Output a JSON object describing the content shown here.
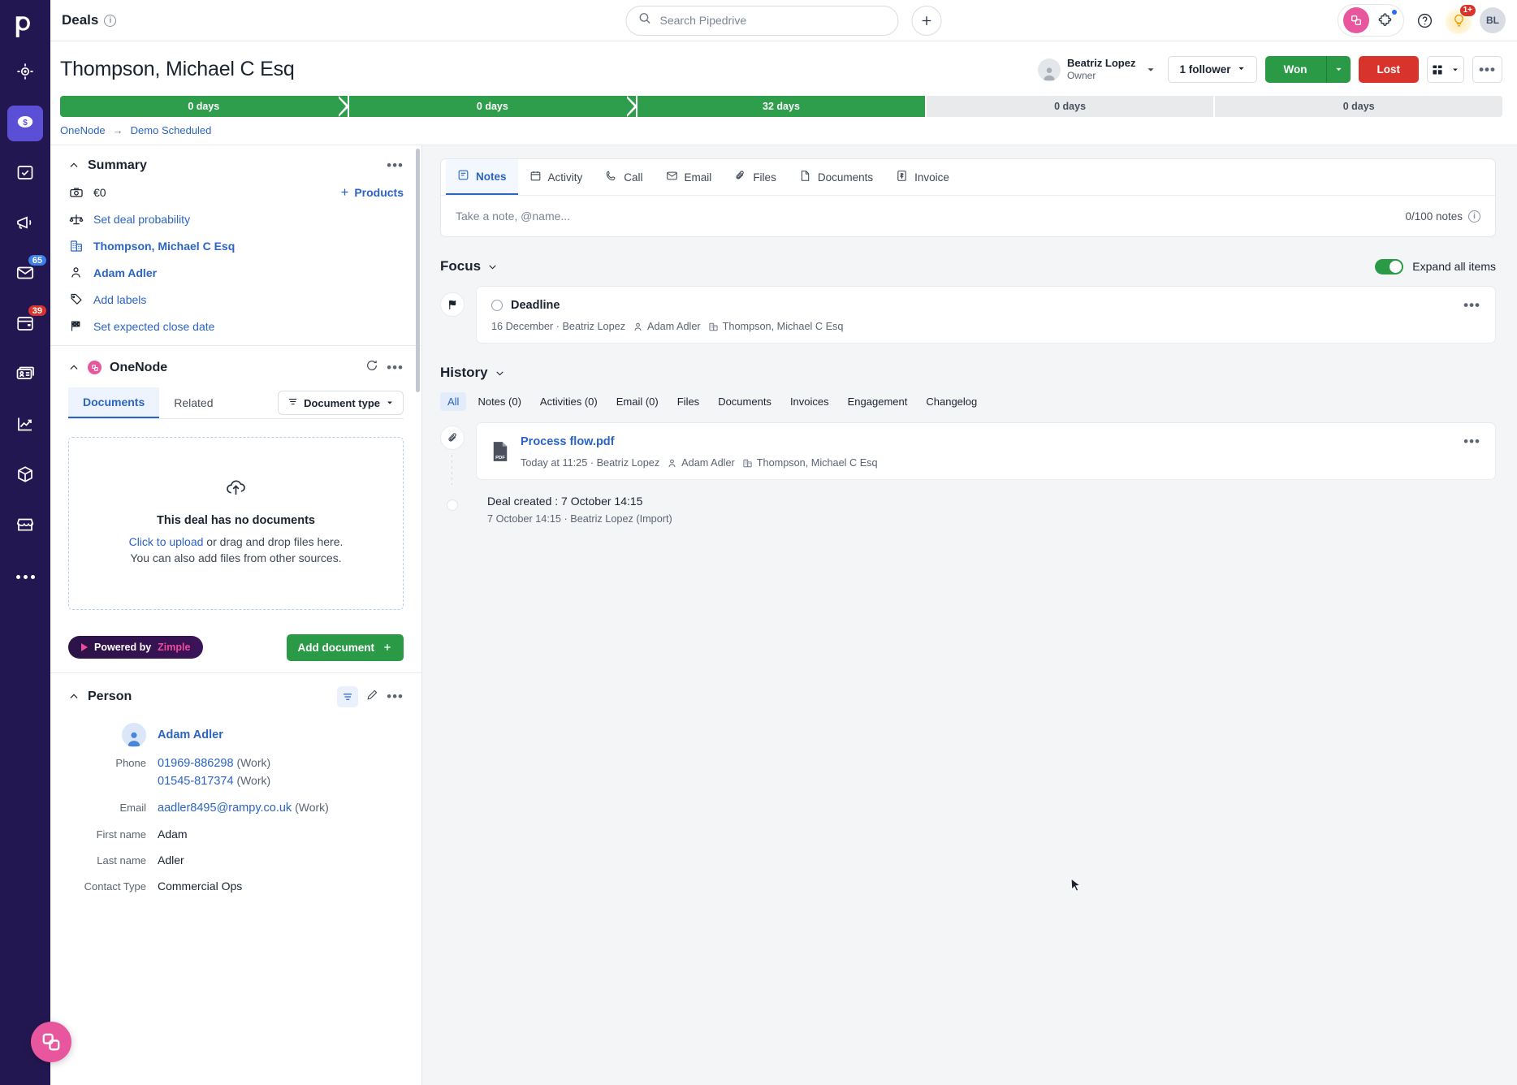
{
  "rail": {
    "logo": "pipedrive-logo",
    "items": [
      {
        "name": "leads-inbox",
        "icon": "target-icon",
        "active": false,
        "badge": null
      },
      {
        "name": "deals",
        "icon": "dollar-coin-icon",
        "active": true,
        "badge": null
      },
      {
        "name": "activities",
        "icon": "calendar-check-icon",
        "active": false,
        "badge": null
      },
      {
        "name": "campaigns",
        "icon": "megaphone-icon",
        "active": false,
        "badge": null
      },
      {
        "name": "mail",
        "icon": "envelope-icon",
        "active": false,
        "badge": "65",
        "badge_color": "#3D7FE8"
      },
      {
        "name": "calendar",
        "icon": "calendar-icon",
        "active": false,
        "badge": "39",
        "badge_color": "#D9342B"
      },
      {
        "name": "contacts",
        "icon": "contact-card-icon",
        "active": false,
        "badge": null
      },
      {
        "name": "insights",
        "icon": "chart-line-icon",
        "active": false,
        "badge": null
      },
      {
        "name": "products",
        "icon": "box-icon",
        "active": false,
        "badge": null
      },
      {
        "name": "marketplace",
        "icon": "storefront-icon",
        "active": false,
        "badge": null
      },
      {
        "name": "more",
        "icon": "ellipsis-icon",
        "active": false,
        "badge": null
      }
    ]
  },
  "topbar": {
    "title": "Deals",
    "search_placeholder": "Search Pipedrive",
    "search_value": "",
    "add_label": "+",
    "notifications_badge": "1+",
    "avatar_initials": "BL"
  },
  "deal": {
    "title": "Thompson, Michael C Esq",
    "owner_name": "Beatriz Lopez",
    "owner_role": "Owner",
    "followers_label": "1 follower",
    "won_label": "Won",
    "lost_label": "Lost",
    "stages": [
      {
        "label": "0 days",
        "state": "done"
      },
      {
        "label": "0 days",
        "state": "done"
      },
      {
        "label": "32 days",
        "state": "done"
      },
      {
        "label": "0 days",
        "state": "todo"
      },
      {
        "label": "0 days",
        "state": "todo"
      }
    ],
    "breadcrumb": {
      "pipeline": "OneNode",
      "separator": "→",
      "stage": "Demo Scheduled"
    }
  },
  "summary": {
    "title": "Summary",
    "products_label": "Products",
    "rows": [
      {
        "icon": "money-icon",
        "text": "€0",
        "link": false
      },
      {
        "icon": "scales-icon",
        "text": "Set deal probability",
        "link": true
      },
      {
        "icon": "organization-icon",
        "text": "Thompson, Michael C Esq",
        "link": true,
        "bold": true
      },
      {
        "icon": "person-icon",
        "text": "Adam Adler",
        "link": true,
        "bold": true
      },
      {
        "icon": "label-tag-icon",
        "text": "Add labels",
        "link": true
      },
      {
        "icon": "flag-checkered-icon",
        "text": "Set expected close date",
        "link": true
      }
    ]
  },
  "onenode": {
    "title": "OneNode",
    "tabs": [
      {
        "label": "Documents",
        "active": true
      },
      {
        "label": "Related",
        "active": false
      }
    ],
    "doc_type_filter": "Document type",
    "dropzone": {
      "title": "This deal has no documents",
      "link": "Click to upload",
      "rest": " or drag and drop files here.",
      "line2": "You can also add files from other sources."
    },
    "powered_by_prefix": "Powered by ",
    "powered_by_brand": "Zimple",
    "add_document_label": "Add document"
  },
  "person": {
    "title": "Person",
    "name": "Adam Adler",
    "fields": [
      {
        "label": "Phone",
        "values": [
          {
            "v": "01969-886298",
            "tag": "(Work)",
            "link": true
          },
          {
            "v": "01545-817374",
            "tag": "(Work)",
            "link": true
          }
        ]
      },
      {
        "label": "Email",
        "values": [
          {
            "v": "aadler8495@rampy.co.uk",
            "tag": "(Work)",
            "link": true
          }
        ]
      },
      {
        "label": "First name",
        "values": [
          {
            "v": "Adam",
            "tag": "",
            "link": false
          }
        ]
      },
      {
        "label": "Last name",
        "values": [
          {
            "v": "Adler",
            "tag": "",
            "link": false
          }
        ]
      },
      {
        "label": "Contact Type",
        "values": [
          {
            "v": "Commercial Ops",
            "tag": "",
            "link": false
          }
        ]
      }
    ]
  },
  "notes_panel": {
    "tabs": [
      {
        "label": "Notes",
        "icon": "note-icon",
        "active": true
      },
      {
        "label": "Activity",
        "icon": "calendar-icon",
        "active": false
      },
      {
        "label": "Call",
        "icon": "phone-icon",
        "active": false
      },
      {
        "label": "Email",
        "icon": "envelope-icon",
        "active": false
      },
      {
        "label": "Files",
        "icon": "paperclip-icon",
        "active": false
      },
      {
        "label": "Documents",
        "icon": "document-icon",
        "active": false
      },
      {
        "label": "Invoice",
        "icon": "invoice-icon",
        "active": false
      }
    ],
    "note_placeholder": "Take a note, @name...",
    "note_value": "",
    "note_counter": "0/100 notes"
  },
  "focus": {
    "title": "Focus",
    "expand_label": "Expand all items",
    "expand_on": true,
    "items": [
      {
        "icon": "flag-icon",
        "title": "Deadline",
        "date": "16 December",
        "author": "Beatriz Lopez",
        "person": "Adam Adler",
        "org": "Thompson, Michael C Esq"
      }
    ]
  },
  "history": {
    "title": "History",
    "filters": [
      {
        "label": "All",
        "active": true
      },
      {
        "label": "Notes (0)",
        "active": false
      },
      {
        "label": "Activities (0)",
        "active": false
      },
      {
        "label": "Email (0)",
        "active": false
      },
      {
        "label": "Files",
        "active": false
      },
      {
        "label": "Documents",
        "active": false
      },
      {
        "label": "Invoices",
        "active": false
      },
      {
        "label": "Engagement",
        "active": false
      },
      {
        "label": "Changelog",
        "active": false
      }
    ],
    "file_item": {
      "icon": "paperclip-icon",
      "file_icon": "pdf-icon",
      "name": "Process flow.pdf",
      "time": "Today at 11:25",
      "author": "Beatriz Lopez",
      "person": "Adam Adler",
      "org": "Thompson, Michael C Esq"
    },
    "created": {
      "title": "Deal created : 7 October 14:15",
      "sub": "7 October 14:15 · Beatriz Lopez (Import)"
    }
  },
  "colors": {
    "brand_navy": "#231751",
    "accent_blue": "#2b64c4",
    "won_green": "#2A9A46",
    "lost_red": "#D9342B",
    "pink": "#E8579E"
  }
}
